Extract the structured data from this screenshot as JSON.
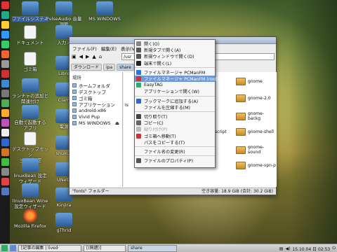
{
  "desktop_icons": [
    {
      "label": "ファイルシステム",
      "kind": "app"
    },
    {
      "label": "PulseAudio 音量\n調節",
      "kind": "app"
    },
    {
      "label": "MS WINDOWS",
      "kind": "app"
    },
    {
      "label": "ドキュメント",
      "kind": "file"
    },
    {
      "label": "入力メ",
      "kind": "app"
    },
    {
      "label": "ゴミ箱",
      "kind": "app"
    },
    {
      "label": "Libre",
      "kind": "app"
    },
    {
      "label": "ランチャの追加と\n関連付け",
      "kind": "app"
    },
    {
      "label": "Clam",
      "kind": "app"
    },
    {
      "label": "自動で起動する\nアプリ",
      "kind": "app"
    },
    {
      "label": "電源",
      "kind": "app"
    },
    {
      "label": "デスクトップセッシ\nョンの設定",
      "kind": "file"
    },
    {
      "label": "shukus",
      "kind": "app"
    },
    {
      "label": "linuxBean 設定\nウィザード",
      "kind": "app"
    },
    {
      "label": "UNetb",
      "kind": "app"
    },
    {
      "label": "linuxBean Wine\n設定ウィザード",
      "kind": "app"
    },
    {
      "label": "Kinjira",
      "kind": "app"
    },
    {
      "label": "Mozilla Firefox",
      "kind": "app"
    },
    {
      "label": "gThrid",
      "kind": "app"
    }
  ],
  "fm": {
    "menubar": [
      "ファイル(F)",
      "編集(E)",
      "表示(V)"
    ],
    "location": "/usr",
    "pathbar": [
      "ダウンロード",
      "ipa",
      "share"
    ],
    "sidebar_header": "場所",
    "sidebar": [
      "ホームフォルダ",
      "デスクトップ",
      "ゴミ箱",
      "アプリケーション",
      "android-x86",
      "Vivid Pup",
      "MS WINDOWS"
    ],
    "left_files": [
      "Is"
    ],
    "right_files": [
      "gnome",
      "gnome-2.0",
      "gnome-backg",
      "gnome-shell",
      "gnome-sound",
      "gnome-vpn-p"
    ],
    "mid_fragments": [
      "bi",
      "postscript"
    ],
    "status_left": "\"fonts\" フォルダー",
    "status_right": "空き容量: 18.9 GiB (合計: 30.2 GiB)"
  },
  "context_menu": [
    {
      "label": "開く(O)",
      "icon": "open-icon"
    },
    {
      "label": "新規タブで開く(A)",
      "icon": "new-tab-icon"
    },
    {
      "label": "新規ウィンドウで開く(D)",
      "icon": "new-window-icon"
    },
    {
      "label": "端末で開く(L)",
      "icon": "terminal-icon"
    },
    {
      "sep": true
    },
    {
      "label": "ファイルマネージャ PCManFM",
      "icon": "pcmanfm-icon"
    },
    {
      "label": "ファイルマネージャ PCManFM (root)",
      "icon": "pcmanfm-root-icon",
      "selected": true
    },
    {
      "label": "EasyTAG",
      "icon": "easytag-icon"
    },
    {
      "label": "アプリケーションで開く(W)",
      "icon": "none"
    },
    {
      "sep": true
    },
    {
      "label": "ブックマークに追加する(A)",
      "icon": "bookmark-icon"
    },
    {
      "label": "ファイルを圧縮する(M)",
      "icon": "none"
    },
    {
      "sep": true
    },
    {
      "label": "切り取り(T)",
      "icon": "cut-icon"
    },
    {
      "label": "コピー(C)",
      "icon": "copy-icon"
    },
    {
      "label": "貼り付け(P)",
      "icon": "paste-icon",
      "disabled": true
    },
    {
      "label": "ゴミ箱へ移動(T)",
      "icon": "trash-icon"
    },
    {
      "label": "パスをコピーする(T)",
      "icon": "none"
    },
    {
      "sep": true
    },
    {
      "label": "ファイル名の変更(R)",
      "icon": "none"
    },
    {
      "sep": true
    },
    {
      "label": "ファイルのプロパティ(P)",
      "icon": "properties-icon"
    }
  ],
  "taskbar": {
    "items": [
      "[記事の編集 | lived·",
      "[(無題)]",
      "share"
    ],
    "clock": "15.10.04 日 02:53"
  }
}
